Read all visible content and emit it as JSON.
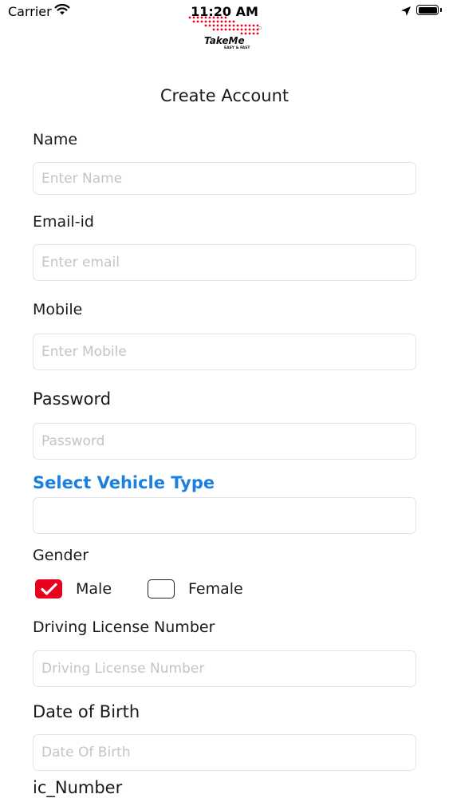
{
  "status_bar": {
    "carrier": "Carrier",
    "time": "11:20 AM"
  },
  "logo": {
    "brand": "TakeMe",
    "tagline": "EASY & FAST",
    "accent_color": "#e8001c"
  },
  "title": "Create Account",
  "form": {
    "name": {
      "label": "Name",
      "placeholder": "Enter Name",
      "value": ""
    },
    "email": {
      "label": "Email-id",
      "placeholder": "Enter email",
      "value": ""
    },
    "mobile": {
      "label": "Mobile",
      "placeholder": "Enter Mobile",
      "value": ""
    },
    "password": {
      "label": "Password",
      "placeholder": "Password",
      "value": ""
    },
    "vehicle_type": {
      "label": "Select Vehicle Type",
      "placeholder": "",
      "value": ""
    },
    "gender": {
      "label": "Gender",
      "options": [
        {
          "label": "Male",
          "checked": true
        },
        {
          "label": "Female",
          "checked": false
        }
      ]
    },
    "driving_license": {
      "label": "Driving License Number",
      "placeholder": "Driving License Number",
      "value": ""
    },
    "dob": {
      "label": "Date of Birth",
      "placeholder": "Date Of Birth",
      "value": ""
    },
    "ic_number": {
      "label": "ic_Number"
    }
  },
  "colors": {
    "accent_blue": "#1a7fe0",
    "check_red": "#e8001c",
    "field_border": "#e3e3e3",
    "placeholder": "#c4c4c8"
  }
}
